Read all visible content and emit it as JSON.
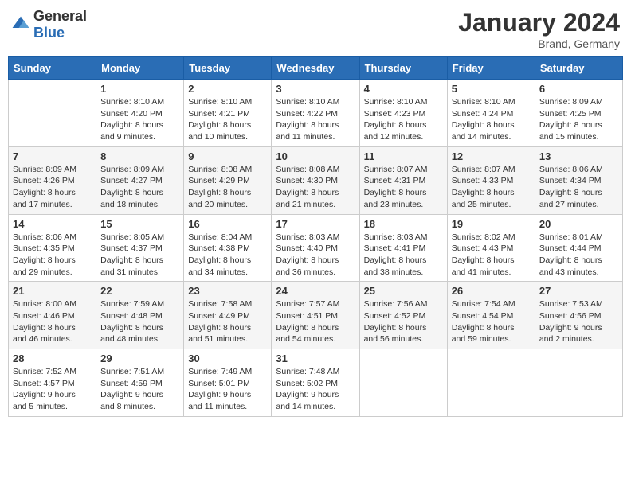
{
  "header": {
    "logo": {
      "general": "General",
      "blue": "Blue"
    },
    "title": "January 2024",
    "location": "Brand, Germany"
  },
  "weekdays": [
    "Sunday",
    "Monday",
    "Tuesday",
    "Wednesday",
    "Thursday",
    "Friday",
    "Saturday"
  ],
  "weeks": [
    [
      {
        "day": "",
        "sunrise": "",
        "sunset": "",
        "daylight": ""
      },
      {
        "day": "1",
        "sunrise": "Sunrise: 8:10 AM",
        "sunset": "Sunset: 4:20 PM",
        "daylight": "Daylight: 8 hours and 9 minutes."
      },
      {
        "day": "2",
        "sunrise": "Sunrise: 8:10 AM",
        "sunset": "Sunset: 4:21 PM",
        "daylight": "Daylight: 8 hours and 10 minutes."
      },
      {
        "day": "3",
        "sunrise": "Sunrise: 8:10 AM",
        "sunset": "Sunset: 4:22 PM",
        "daylight": "Daylight: 8 hours and 11 minutes."
      },
      {
        "day": "4",
        "sunrise": "Sunrise: 8:10 AM",
        "sunset": "Sunset: 4:23 PM",
        "daylight": "Daylight: 8 hours and 12 minutes."
      },
      {
        "day": "5",
        "sunrise": "Sunrise: 8:10 AM",
        "sunset": "Sunset: 4:24 PM",
        "daylight": "Daylight: 8 hours and 14 minutes."
      },
      {
        "day": "6",
        "sunrise": "Sunrise: 8:09 AM",
        "sunset": "Sunset: 4:25 PM",
        "daylight": "Daylight: 8 hours and 15 minutes."
      }
    ],
    [
      {
        "day": "7",
        "sunrise": "Sunrise: 8:09 AM",
        "sunset": "Sunset: 4:26 PM",
        "daylight": "Daylight: 8 hours and 17 minutes."
      },
      {
        "day": "8",
        "sunrise": "Sunrise: 8:09 AM",
        "sunset": "Sunset: 4:27 PM",
        "daylight": "Daylight: 8 hours and 18 minutes."
      },
      {
        "day": "9",
        "sunrise": "Sunrise: 8:08 AM",
        "sunset": "Sunset: 4:29 PM",
        "daylight": "Daylight: 8 hours and 20 minutes."
      },
      {
        "day": "10",
        "sunrise": "Sunrise: 8:08 AM",
        "sunset": "Sunset: 4:30 PM",
        "daylight": "Daylight: 8 hours and 21 minutes."
      },
      {
        "day": "11",
        "sunrise": "Sunrise: 8:07 AM",
        "sunset": "Sunset: 4:31 PM",
        "daylight": "Daylight: 8 hours and 23 minutes."
      },
      {
        "day": "12",
        "sunrise": "Sunrise: 8:07 AM",
        "sunset": "Sunset: 4:33 PM",
        "daylight": "Daylight: 8 hours and 25 minutes."
      },
      {
        "day": "13",
        "sunrise": "Sunrise: 8:06 AM",
        "sunset": "Sunset: 4:34 PM",
        "daylight": "Daylight: 8 hours and 27 minutes."
      }
    ],
    [
      {
        "day": "14",
        "sunrise": "Sunrise: 8:06 AM",
        "sunset": "Sunset: 4:35 PM",
        "daylight": "Daylight: 8 hours and 29 minutes."
      },
      {
        "day": "15",
        "sunrise": "Sunrise: 8:05 AM",
        "sunset": "Sunset: 4:37 PM",
        "daylight": "Daylight: 8 hours and 31 minutes."
      },
      {
        "day": "16",
        "sunrise": "Sunrise: 8:04 AM",
        "sunset": "Sunset: 4:38 PM",
        "daylight": "Daylight: 8 hours and 34 minutes."
      },
      {
        "day": "17",
        "sunrise": "Sunrise: 8:03 AM",
        "sunset": "Sunset: 4:40 PM",
        "daylight": "Daylight: 8 hours and 36 minutes."
      },
      {
        "day": "18",
        "sunrise": "Sunrise: 8:03 AM",
        "sunset": "Sunset: 4:41 PM",
        "daylight": "Daylight: 8 hours and 38 minutes."
      },
      {
        "day": "19",
        "sunrise": "Sunrise: 8:02 AM",
        "sunset": "Sunset: 4:43 PM",
        "daylight": "Daylight: 8 hours and 41 minutes."
      },
      {
        "day": "20",
        "sunrise": "Sunrise: 8:01 AM",
        "sunset": "Sunset: 4:44 PM",
        "daylight": "Daylight: 8 hours and 43 minutes."
      }
    ],
    [
      {
        "day": "21",
        "sunrise": "Sunrise: 8:00 AM",
        "sunset": "Sunset: 4:46 PM",
        "daylight": "Daylight: 8 hours and 46 minutes."
      },
      {
        "day": "22",
        "sunrise": "Sunrise: 7:59 AM",
        "sunset": "Sunset: 4:48 PM",
        "daylight": "Daylight: 8 hours and 48 minutes."
      },
      {
        "day": "23",
        "sunrise": "Sunrise: 7:58 AM",
        "sunset": "Sunset: 4:49 PM",
        "daylight": "Daylight: 8 hours and 51 minutes."
      },
      {
        "day": "24",
        "sunrise": "Sunrise: 7:57 AM",
        "sunset": "Sunset: 4:51 PM",
        "daylight": "Daylight: 8 hours and 54 minutes."
      },
      {
        "day": "25",
        "sunrise": "Sunrise: 7:56 AM",
        "sunset": "Sunset: 4:52 PM",
        "daylight": "Daylight: 8 hours and 56 minutes."
      },
      {
        "day": "26",
        "sunrise": "Sunrise: 7:54 AM",
        "sunset": "Sunset: 4:54 PM",
        "daylight": "Daylight: 8 hours and 59 minutes."
      },
      {
        "day": "27",
        "sunrise": "Sunrise: 7:53 AM",
        "sunset": "Sunset: 4:56 PM",
        "daylight": "Daylight: 9 hours and 2 minutes."
      }
    ],
    [
      {
        "day": "28",
        "sunrise": "Sunrise: 7:52 AM",
        "sunset": "Sunset: 4:57 PM",
        "daylight": "Daylight: 9 hours and 5 minutes."
      },
      {
        "day": "29",
        "sunrise": "Sunrise: 7:51 AM",
        "sunset": "Sunset: 4:59 PM",
        "daylight": "Daylight: 9 hours and 8 minutes."
      },
      {
        "day": "30",
        "sunrise": "Sunrise: 7:49 AM",
        "sunset": "Sunset: 5:01 PM",
        "daylight": "Daylight: 9 hours and 11 minutes."
      },
      {
        "day": "31",
        "sunrise": "Sunrise: 7:48 AM",
        "sunset": "Sunset: 5:02 PM",
        "daylight": "Daylight: 9 hours and 14 minutes."
      },
      {
        "day": "",
        "sunrise": "",
        "sunset": "",
        "daylight": ""
      },
      {
        "day": "",
        "sunrise": "",
        "sunset": "",
        "daylight": ""
      },
      {
        "day": "",
        "sunrise": "",
        "sunset": "",
        "daylight": ""
      }
    ]
  ]
}
